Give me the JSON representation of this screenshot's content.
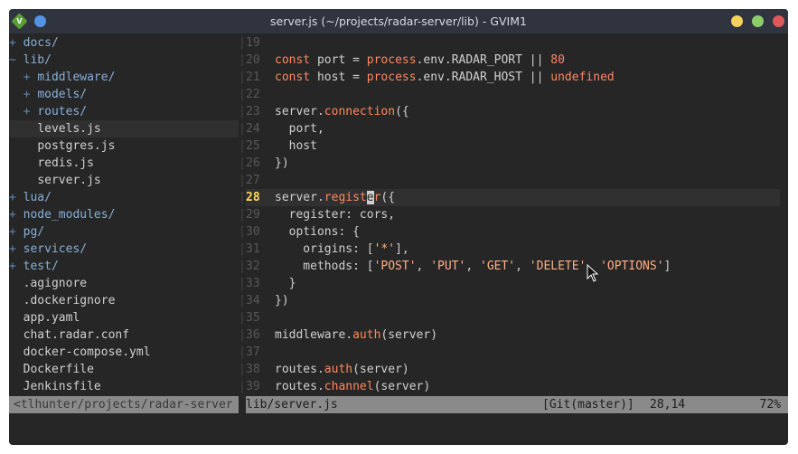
{
  "window": {
    "title": "server.js (~/projects/radar-server/lib) - GVIM1",
    "app_icon_letter": "V"
  },
  "tree": [
    {
      "sign": "+ ",
      "name": "docs/",
      "kind": "dir"
    },
    {
      "sign": "~ ",
      "name": "lib/",
      "kind": "dir"
    },
    {
      "sign": "  + ",
      "name": "middleware/",
      "kind": "dir"
    },
    {
      "sign": "  + ",
      "name": "models/",
      "kind": "dir"
    },
    {
      "sign": "  + ",
      "name": "routes/",
      "kind": "dir"
    },
    {
      "sign": "    ",
      "name": "levels.js",
      "kind": "file",
      "selected": true
    },
    {
      "sign": "    ",
      "name": "postgres.js",
      "kind": "file"
    },
    {
      "sign": "    ",
      "name": "redis.js",
      "kind": "file"
    },
    {
      "sign": "    ",
      "name": "server.js",
      "kind": "file"
    },
    {
      "sign": "+ ",
      "name": "lua/",
      "kind": "dir"
    },
    {
      "sign": "+ ",
      "name": "node_modules/",
      "kind": "dir"
    },
    {
      "sign": "+ ",
      "name": "pg/",
      "kind": "dir"
    },
    {
      "sign": "+ ",
      "name": "services/",
      "kind": "dir"
    },
    {
      "sign": "+ ",
      "name": "test/",
      "kind": "dir"
    },
    {
      "sign": "  ",
      "name": ".agignore",
      "kind": "file"
    },
    {
      "sign": "  ",
      "name": ".dockerignore",
      "kind": "file"
    },
    {
      "sign": "  ",
      "name": "app.yaml",
      "kind": "file"
    },
    {
      "sign": "  ",
      "name": "chat.radar.conf",
      "kind": "file"
    },
    {
      "sign": "  ",
      "name": "docker-compose.yml",
      "kind": "file"
    },
    {
      "sign": "  ",
      "name": "Dockerfile",
      "kind": "file"
    },
    {
      "sign": "  ",
      "name": "Jenkinsfile",
      "kind": "file"
    }
  ],
  "split_char": "|",
  "editor": {
    "current_line": 28,
    "lines": [
      {
        "n": "19",
        "tokens": []
      },
      {
        "n": "20",
        "tokens": [
          [
            "kw",
            "const"
          ],
          [
            "code",
            " port = "
          ],
          [
            "gl",
            "process"
          ],
          [
            "code",
            ".env.RADAR_PORT "
          ],
          [
            "op",
            "||"
          ],
          [
            "code",
            " "
          ],
          [
            "num",
            "80"
          ]
        ]
      },
      {
        "n": "21",
        "tokens": [
          [
            "kw",
            "const"
          ],
          [
            "code",
            " host = "
          ],
          [
            "gl",
            "process"
          ],
          [
            "code",
            ".env.RADAR_HOST "
          ],
          [
            "op",
            "||"
          ],
          [
            "code",
            " "
          ],
          [
            "num",
            "undefined"
          ]
        ]
      },
      {
        "n": "22",
        "tokens": []
      },
      {
        "n": "23",
        "tokens": [
          [
            "code",
            "server."
          ],
          [
            "fn",
            "connection"
          ],
          [
            "code",
            "({"
          ]
        ]
      },
      {
        "n": "24",
        "tokens": [
          [
            "code",
            "  port,"
          ]
        ]
      },
      {
        "n": "25",
        "tokens": [
          [
            "code",
            "  host"
          ]
        ]
      },
      {
        "n": "26",
        "tokens": [
          [
            "code",
            "})"
          ]
        ]
      },
      {
        "n": "27",
        "tokens": []
      },
      {
        "n": "28",
        "tokens": [
          [
            "code",
            "server."
          ],
          [
            "fn",
            "regist"
          ],
          [
            "cursor",
            "e"
          ],
          [
            "fn",
            "r"
          ],
          [
            "code",
            "({"
          ]
        ]
      },
      {
        "n": "29",
        "tokens": [
          [
            "code",
            "  register: cors,"
          ]
        ]
      },
      {
        "n": "30",
        "tokens": [
          [
            "code",
            "  options: {"
          ]
        ]
      },
      {
        "n": "31",
        "tokens": [
          [
            "code",
            "    origins: ["
          ],
          [
            "str",
            "'*'"
          ],
          [
            "code",
            "],"
          ]
        ]
      },
      {
        "n": "32",
        "tokens": [
          [
            "code",
            "    methods: ["
          ],
          [
            "str",
            "'POST'"
          ],
          [
            "code",
            ", "
          ],
          [
            "str",
            "'PUT'"
          ],
          [
            "code",
            ", "
          ],
          [
            "str",
            "'GET'"
          ],
          [
            "code",
            ", "
          ],
          [
            "str",
            "'DELETE'"
          ],
          [
            "code",
            ", "
          ],
          [
            "str",
            "'OPTIONS'"
          ],
          [
            "code",
            "]"
          ]
        ]
      },
      {
        "n": "33",
        "tokens": [
          [
            "code",
            "  }"
          ]
        ]
      },
      {
        "n": "34",
        "tokens": [
          [
            "code",
            "})"
          ]
        ]
      },
      {
        "n": "35",
        "tokens": []
      },
      {
        "n": "36",
        "tokens": [
          [
            "code",
            "middleware."
          ],
          [
            "fn",
            "auth"
          ],
          [
            "code",
            "(server)"
          ]
        ]
      },
      {
        "n": "37",
        "tokens": []
      },
      {
        "n": "38",
        "tokens": [
          [
            "code",
            "routes."
          ],
          [
            "fn",
            "auth"
          ],
          [
            "code",
            "(server)"
          ]
        ]
      },
      {
        "n": "39",
        "tokens": [
          [
            "code",
            "routes."
          ],
          [
            "fn",
            "channel"
          ],
          [
            "code",
            "(server)"
          ]
        ]
      }
    ]
  },
  "status": {
    "tree_path": "<tlhunter/projects/radar-server",
    "file": "lib/server.js",
    "git": "[Git(master)]",
    "position": "28,14",
    "percent": "72%"
  }
}
